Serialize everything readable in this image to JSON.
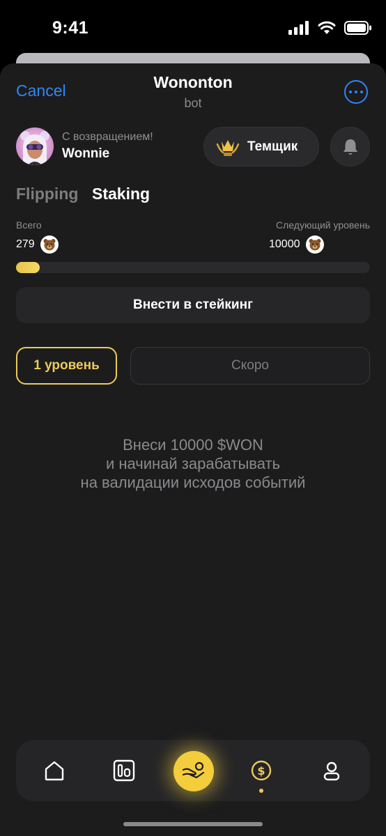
{
  "status_bar": {
    "time": "9:41"
  },
  "header": {
    "cancel_label": "Cancel",
    "title": "Wononton",
    "subtitle": "bot",
    "more_icon": "more-icon"
  },
  "user": {
    "greeting": "С возвращением!",
    "name": "Wonnie"
  },
  "rank": {
    "label": "Темщик",
    "icon": "crown-icon"
  },
  "tabs": [
    {
      "label": "Flipping",
      "active": false
    },
    {
      "label": "Staking",
      "active": true
    }
  ],
  "stats": {
    "total_label": "Всего",
    "total_value": "279",
    "next_label": "Следующий уровень",
    "next_value": "10000"
  },
  "progress": {
    "fraction": 0.0279,
    "color": "#f2d15a"
  },
  "stake_button_label": "Внести в стейкинг",
  "levels": {
    "level_label": "1 уровень",
    "soon_label": "Скоро"
  },
  "info": {
    "line1": "Внеси 10000 $WON",
    "line2": "и начинай зарабатывать",
    "line3": "на валидации исходов событий"
  },
  "bottom_nav": {
    "items": [
      "home-icon",
      "cards-icon",
      "staking-icon",
      "coin-icon",
      "profile-icon"
    ],
    "active": "coin-icon"
  },
  "colors": {
    "accent": "#ecca5c",
    "link": "#2f86f5",
    "background": "#1c1c1d"
  }
}
